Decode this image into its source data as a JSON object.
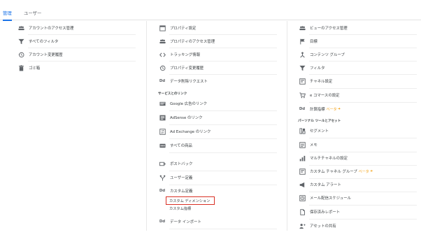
{
  "tabs": {
    "admin": "管理",
    "user": "ユーザー"
  },
  "account": {
    "access": "アカウントのアクセス管理",
    "filters": "すべてのフィルタ",
    "history": "アカウント変更履歴",
    "trash": "ゴミ箱"
  },
  "property": {
    "settings": "プロパティ設定",
    "access": "プロパティのアクセス管理",
    "tracking": "トラッキング情報",
    "history": "プロパティ変更履歴",
    "deletion": "データ削除リクエスト",
    "links_header": "サービスとのリンク",
    "google_ads": "Google 広告のリンク",
    "adsense": "AdSense のリンク",
    "adexchange": "Ad Exchange のリンク",
    "all_products": "すべての商品",
    "postback": "ポストバック",
    "user_defs": "ユーザー定義",
    "custom_defs": "カスタム定義",
    "custom_dimensions": "カスタム ディメンション",
    "custom_metrics": "カスタム指標",
    "data_import": "データ インポート"
  },
  "view": {
    "access": "ビューのアクセス管理",
    "goals": "目標",
    "content_group": "コンテンツ グループ",
    "filters": "フィルタ",
    "channel": "チャネル設定",
    "ecommerce": "e コマースの設定",
    "calc_metrics": "計算指標",
    "beta": "ベータ",
    "personal_header": "パーソナル ツールとアセット",
    "segments": "セグメント",
    "notes": "メモ",
    "multichannel": "マルチチャネルの設定",
    "custom_channel": "カスタム チャネル グループ",
    "custom_alerts": "カスタム アラート",
    "email_schedule": "メール配信スケジュール",
    "saved_reports": "保存済みレポート",
    "share_assets": "アセットの共有"
  },
  "icons": {
    "dd": "Dd"
  },
  "colors": {
    "accent": "#1a73e8",
    "highlight": "#d93025",
    "beta": "#f29900"
  }
}
